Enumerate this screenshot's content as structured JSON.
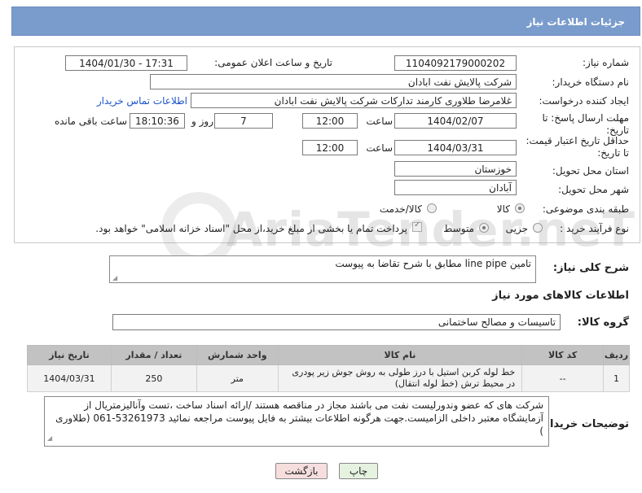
{
  "header": {
    "title": "جزئیات اطلاعات نیاز"
  },
  "form": {
    "need_number_label": "شماره نیاز:",
    "need_number": "1104092179000202",
    "announce_label": "تاریخ و ساعت اعلان عمومی:",
    "announce_value": "1404/01/30 - 17:31",
    "buyer_org_label": "نام دستگاه خریدار:",
    "buyer_org": "شرکت پالایش نفت ابادان",
    "requester_label": "ایجاد کننده درخواست:",
    "requester": "غلامرضا طلاوری کارمند تدارکات شرکت پالایش نفت ابادان",
    "contact_link": "اطلاعات تماس خریدار",
    "deadline_label_line1": "مهلت ارسال پاسخ: تا",
    "deadline_label_line2": "تاریخ:",
    "deadline_date": "1404/02/07",
    "hour_label": "ساعت",
    "deadline_time": "12:00",
    "days_value": "7",
    "days_label": "روز و",
    "remaining_time": "18:10:36",
    "remaining_label": "ساعت باقی مانده",
    "min_price_label_line1": "حداقل تاریخ اعتبار قیمت:",
    "min_price_label_line2": "تا تاریخ:",
    "min_price_date": "1404/03/31",
    "min_price_time": "12:00",
    "province_label": "استان محل تحویل:",
    "province": "خوزستان",
    "city_label": "شهر محل تحویل:",
    "city": "آبادان",
    "category_label": "طبقه بندی موضوعی:",
    "category_options": [
      "کالا",
      "کالا/خدمت"
    ],
    "process_label": "نوع فرآیند خرید :",
    "process_options": [
      "جزیی",
      "متوسط"
    ],
    "payment_note": "پرداخت تمام یا بخشی از مبلغ خرید،از محل \"اسناد خزانه اسلامی\" خواهد بود."
  },
  "summary": {
    "label": "شرح کلی نیاز:",
    "value": "تامین line pipe مطابق با شرح تقاضا به پیوست"
  },
  "goods_info": {
    "title": "اطلاعات کالاهای مورد نیاز",
    "group_label": "گروه کالا:",
    "group_value": "تاسیسات و مصالح ساختمانی"
  },
  "table": {
    "headers": [
      "ردیف",
      "کد کالا",
      "نام کالا",
      "واحد شمارش",
      "تعداد / مقدار",
      "تاریخ نیاز"
    ],
    "rows": [
      [
        "1",
        "--",
        "خط لوله کربن استیل با درز طولی به روش جوش زیر پودری در محیط ترش (خط لوله انتقال)",
        "متر",
        "250",
        "1404/03/31"
      ]
    ]
  },
  "buyer_notes": {
    "label": "توضیحات خریدار:",
    "text": "شرکت های که عضو وندورلیست نفت می باشند مجاز در مناقصه هستند /ارائه اسناد ساخت ،تست وآنالیزمتریال از آزمایشگاه معتبر داخلی الزامیست.جهت هرگونه اطلاعات بیشتر به فایل پیوست مراجعه نمائید 53261973-061 (طلاوری )"
  },
  "buttons": {
    "print": "چاپ",
    "back": "بازگشت"
  },
  "watermark": "AriaTender.neT",
  "colors": {
    "header": "#7a9ccd",
    "link": "#1a55c8",
    "table_header": "#c2c2c2",
    "back_button": "#f7dede",
    "print_button": "#e6f2e0"
  }
}
